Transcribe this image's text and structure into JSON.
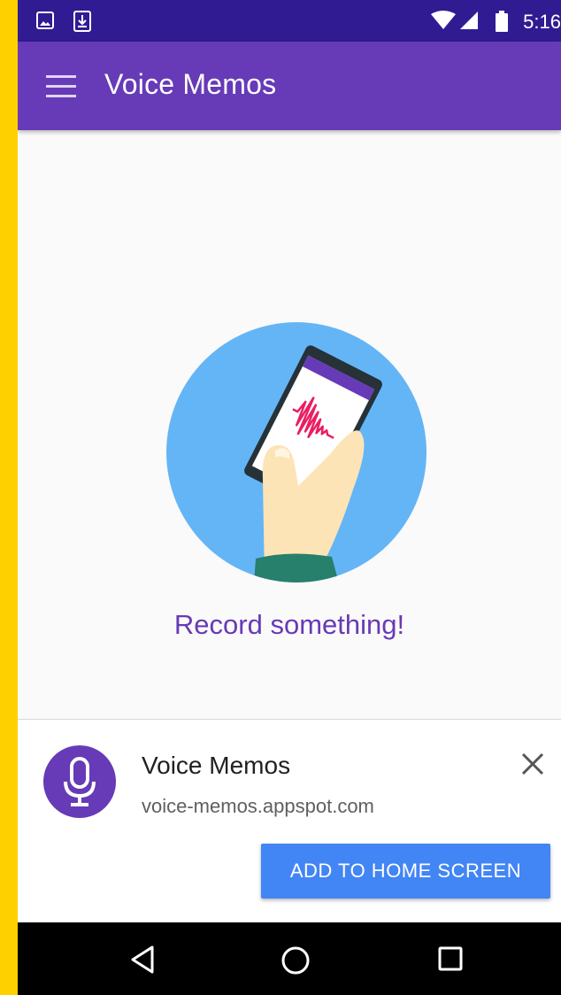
{
  "status_bar": {
    "time": "5:16",
    "icons": [
      "image-icon",
      "download-icon",
      "wifi-icon",
      "signal-icon",
      "battery-icon"
    ]
  },
  "app_bar": {
    "title": "Voice Memos",
    "menu_icon": "hamburger-menu-icon"
  },
  "main": {
    "illustration": "hand-holding-phone-recording-illustration",
    "empty_message": "Record something!"
  },
  "install_banner": {
    "app_name": "Voice Memos",
    "url": "voice-memos.appspot.com",
    "button_label": "ADD TO HOME SCREEN",
    "icon": "microphone-icon",
    "close_icon": "close-icon"
  },
  "nav_bar": {
    "buttons": [
      "back-icon",
      "home-icon",
      "recents-icon"
    ]
  },
  "colors": {
    "status_bar": "#311B92",
    "app_bar": "#673AB7",
    "accent_text": "#673AB7",
    "button": "#4285F4",
    "illustration_bg": "#64B5F6",
    "frame": "#FFD000"
  }
}
